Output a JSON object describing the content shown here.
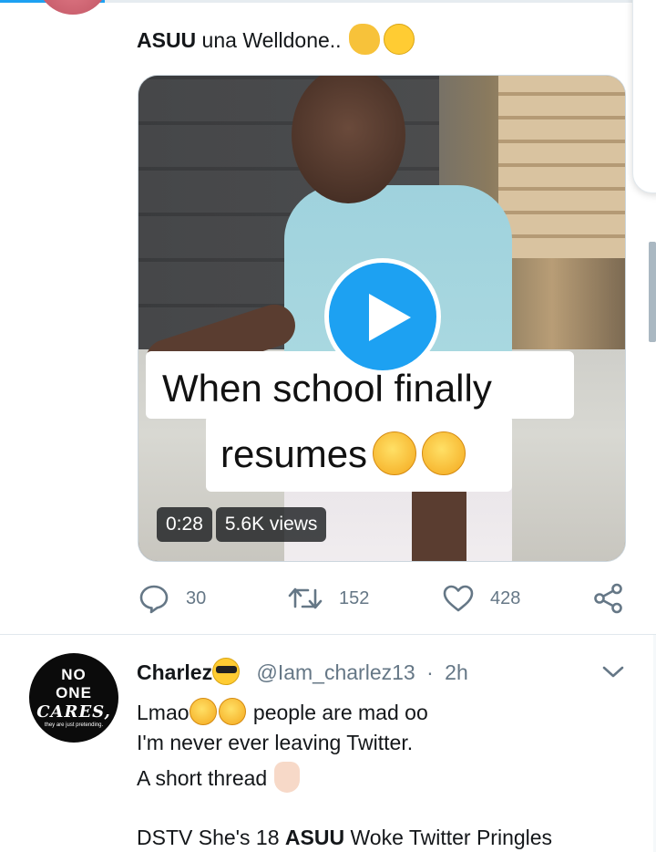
{
  "tweet": {
    "text_bold": "ASUU",
    "text_rest": " una Welldone..",
    "emojis": [
      "clapping-hands",
      "grinning-face"
    ]
  },
  "video": {
    "caption_line1": "When school finally",
    "caption_line2": "resumes",
    "duration": "0:28",
    "views": "5.6K views"
  },
  "actions": {
    "replies": "30",
    "retweets": "152",
    "likes": "428"
  },
  "reply": {
    "avatar_text": {
      "line1": "NO",
      "line2": "ONE",
      "line3": "CARES,",
      "line4": "they are just pretending."
    },
    "name": "Charlez",
    "handle": "@Iam_charlez13",
    "separator": "·",
    "time": "2h",
    "line1_prefix": "Lmao",
    "line1_suffix": " people are mad oo",
    "line2": "I'm never ever leaving Twitter.",
    "line3": "A short thread",
    "line4_a": "DSTV She's 18 ",
    "line4_bold": "ASUU",
    "line4_b": " Woke Twitter Pringles"
  },
  "colors": {
    "accent": "#1da1f2",
    "muted": "#657786",
    "text": "#14171a"
  },
  "top_progress_fraction": 0.16
}
